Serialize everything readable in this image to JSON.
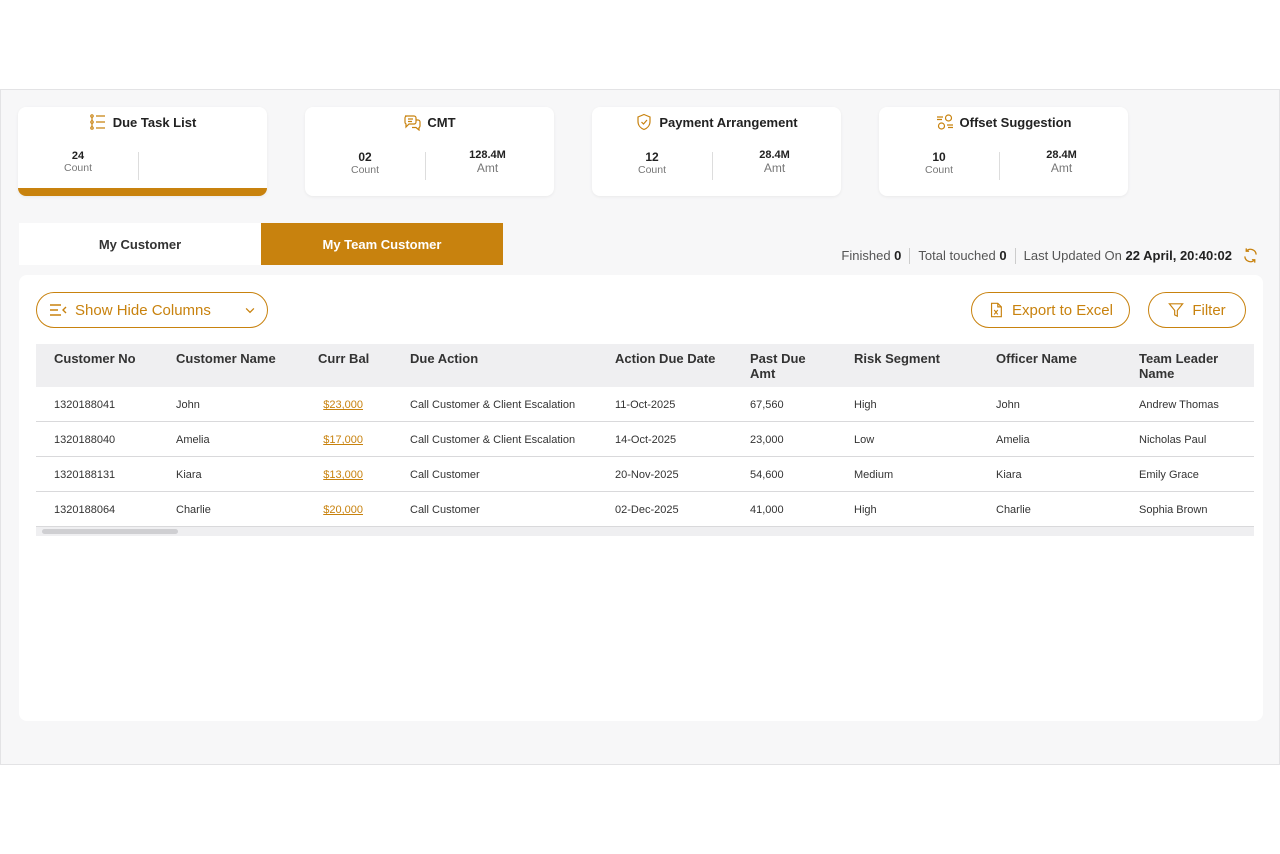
{
  "colors": {
    "accent": "#c8820e",
    "panel_bg": "#f7f7f8"
  },
  "cards": [
    {
      "title": "Due Task List",
      "icon": "list-icon",
      "count": "24",
      "count_label": "Count",
      "amount": "",
      "amount_label": "",
      "active": true
    },
    {
      "title": "CMT",
      "icon": "chat-icon",
      "count": "02",
      "count_label": "Count",
      "amount": "128.4M",
      "amount_label": "Amt"
    },
    {
      "title": "Payment Arrangement",
      "icon": "shield-icon",
      "count": "12",
      "count_label": "Count",
      "amount": "28.4M",
      "amount_label": "Amt"
    },
    {
      "title": "Offset Suggestion",
      "icon": "offset-icon",
      "count": "10",
      "count_label": "Count",
      "amount": "28.4M",
      "amount_label": "Amt"
    }
  ],
  "tabs": [
    {
      "label": "My Customer",
      "active": false
    },
    {
      "label": "My Team Customer",
      "active": true
    }
  ],
  "status": {
    "finished_label": "Finished",
    "finished_value": "0",
    "touched_label": "Total touched",
    "touched_value": "0",
    "updated_label": "Last Updated On",
    "updated_value": "22 April, 20:40:02"
  },
  "toolbar": {
    "columns_label": "Show Hide Columns",
    "export_label": "Export to Excel",
    "filter_label": "Filter"
  },
  "table": {
    "headers": [
      "Customer No",
      "Customer Name",
      "Curr Bal",
      "Due Action",
      "Action Due Date",
      "Past Due Amt",
      "Risk Segment",
      "Officer Name",
      "Team Leader Name"
    ],
    "rows": [
      [
        "1320188041",
        "John",
        "$23,000",
        "Call Customer & Client Escalation",
        "11-Oct-2025",
        "67,560",
        "High",
        "John",
        "Andrew Thomas"
      ],
      [
        "1320188040",
        "Amelia",
        "$17,000",
        "Call Customer & Client Escalation",
        "14-Oct-2025",
        "23,000",
        "Low",
        "Amelia",
        "Nicholas Paul"
      ],
      [
        "1320188131",
        "Kiara",
        "$13,000",
        "Call Customer",
        "20-Nov-2025",
        "54,600",
        "Medium",
        "Kiara",
        "Emily Grace"
      ],
      [
        "1320188064",
        "Charlie",
        "$20,000",
        "Call Customer",
        "02-Dec-2025",
        "41,000",
        "High",
        "Charlie",
        "Sophia Brown"
      ]
    ]
  }
}
